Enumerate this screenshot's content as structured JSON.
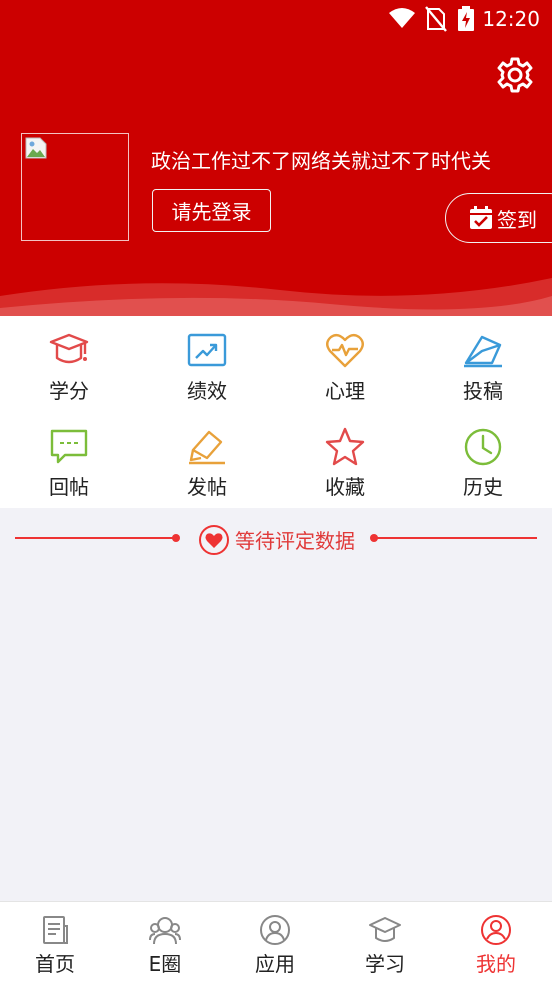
{
  "status_bar": {
    "time": "12:20"
  },
  "profile": {
    "slogan": "政治工作过不了网络关就过不了时代关",
    "login_label": "请先登录",
    "signin_label": "签到"
  },
  "quick_grid": [
    {
      "label": "学分",
      "icon": "graduation-cap-icon",
      "color": "#e24a4a"
    },
    {
      "label": "绩效",
      "icon": "trend-chart-icon",
      "color": "#3a9ad9"
    },
    {
      "label": "心理",
      "icon": "heart-pulse-icon",
      "color": "#e8a13a"
    },
    {
      "label": "投稿",
      "icon": "envelope-icon",
      "color": "#3a9ad9"
    },
    {
      "label": "回帖",
      "icon": "comment-icon",
      "color": "#7cbd3a"
    },
    {
      "label": "发帖",
      "icon": "pencil-icon",
      "color": "#e8a13a"
    },
    {
      "label": "收藏",
      "icon": "star-icon",
      "color": "#e24a4a"
    },
    {
      "label": "历史",
      "icon": "clock-icon",
      "color": "#7cbd3a"
    }
  ],
  "empty_state": {
    "message": "等待评定数据"
  },
  "tabs": [
    {
      "label": "首页",
      "icon": "home-doc-icon",
      "active": false
    },
    {
      "label": "E圈",
      "icon": "people-icon",
      "active": false
    },
    {
      "label": "应用",
      "icon": "user-circle-icon",
      "active": false
    },
    {
      "label": "学习",
      "icon": "graduation-cap-icon",
      "active": false
    },
    {
      "label": "我的",
      "icon": "profile-icon",
      "active": true
    }
  ],
  "colors": {
    "brand_red": "#cc0000",
    "accent_red": "#e33333",
    "background": "#f2f2f7"
  }
}
